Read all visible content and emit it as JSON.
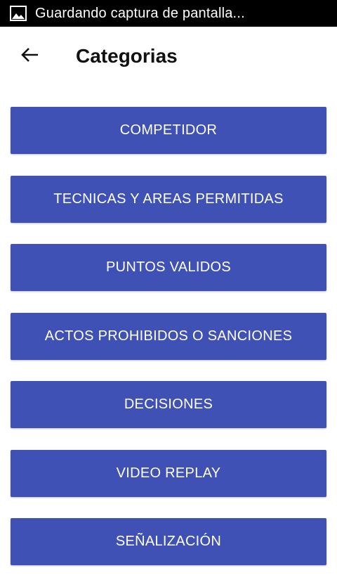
{
  "status_bar": {
    "notification_icon": "image-icon",
    "text": "Guardando captura de pantalla..."
  },
  "app_bar": {
    "back_icon": "arrow-left-icon",
    "title": "Categorias"
  },
  "colors": {
    "button_background": "#3f51b5",
    "button_text": "#ffffff",
    "status_bar": "#000000"
  },
  "categories": [
    {
      "label": "COMPETIDOR"
    },
    {
      "label": "TECNICAS Y AREAS PERMITIDAS"
    },
    {
      "label": "PUNTOS VALIDOS"
    },
    {
      "label": "ACTOS PROHIBIDOS O SANCIONES"
    },
    {
      "label": "DECISIONES"
    },
    {
      "label": "VIDEO REPLAY"
    },
    {
      "label": "SEÑALIZACIÓN"
    }
  ]
}
